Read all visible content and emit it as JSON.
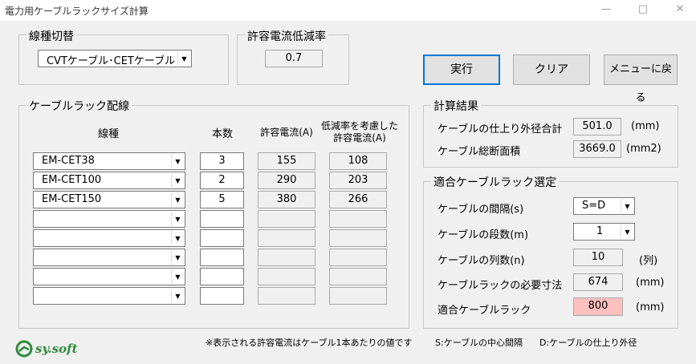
{
  "window": {
    "title": "電力用ケーブルラックサイズ計算",
    "minimize": "—",
    "maximize": "□",
    "close": "✕"
  },
  "wire_type": {
    "group_label": "線種切替",
    "selected": "CVTケーブル･CETケーブル"
  },
  "reduction": {
    "group_label": "許容電流低減率",
    "value": "0.7"
  },
  "buttons": {
    "run": "実行",
    "clear": "クリア",
    "menu": "メニューに戻る"
  },
  "rack": {
    "group_label": "ケーブルラック配線",
    "headers": {
      "type": "線種",
      "count": "本数",
      "allowable": "許容電流(A)",
      "reduced_line1": "低減率を考慮した",
      "reduced_line2": "許容電流(A)"
    },
    "rows": [
      {
        "type": "EM-CET38",
        "count": "3",
        "allowable": "155",
        "reduced": "108"
      },
      {
        "type": "EM-CET100",
        "count": "2",
        "allowable": "290",
        "reduced": "203"
      },
      {
        "type": "EM-CET150",
        "count": "5",
        "allowable": "380",
        "reduced": "266"
      },
      {
        "type": "",
        "count": "",
        "allowable": "",
        "reduced": ""
      },
      {
        "type": "",
        "count": "",
        "allowable": "",
        "reduced": ""
      },
      {
        "type": "",
        "count": "",
        "allowable": "",
        "reduced": ""
      },
      {
        "type": "",
        "count": "",
        "allowable": "",
        "reduced": ""
      },
      {
        "type": "",
        "count": "",
        "allowable": "",
        "reduced": ""
      }
    ]
  },
  "result": {
    "group_label": "計算結果",
    "outer_label": "ケーブルの仕上り外径合計",
    "outer_value": "501.0",
    "outer_unit": "(mm)",
    "area_label": "ケーブル総断面積",
    "area_value": "3669.0",
    "area_unit": "(mm2)"
  },
  "select": {
    "group_label": "適合ケーブルラック選定",
    "spacing_label": "ケーブルの間隔(s)",
    "spacing_value": "S=D",
    "tiers_label": "ケーブルの段数(m)",
    "tiers_value": "1",
    "columns_label": "ケーブルの列数(n)",
    "columns_value": "10",
    "columns_unit": "(列)",
    "size_label": "ケーブルラックの必要寸法",
    "size_value": "674",
    "size_unit": "(mm)",
    "fit_label": "適合ケーブルラック",
    "fit_value": "800",
    "fit_unit": "(mm)"
  },
  "footer": {
    "logo": "sy.soft",
    "note": "※表示される許容電流はケーブル1本あたりの値です",
    "legend_s": "S:ケーブルの中心間隔",
    "legend_d": "D:ケーブルの仕上り外径"
  }
}
